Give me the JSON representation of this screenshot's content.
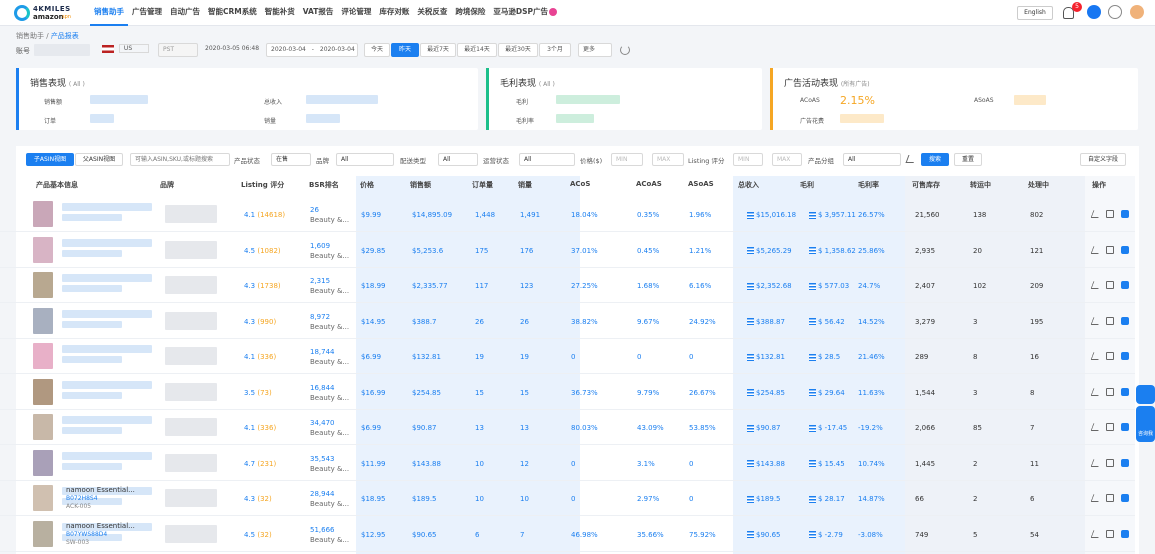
{
  "logo": {
    "line1": "4KMILES",
    "line2": "amazon",
    "line3": "spn"
  },
  "nav": [
    "销售助手",
    "广告管理",
    "自动广告",
    "智能CRM系统",
    "智能补货",
    "VAT报告",
    "评论管理",
    "库存对账",
    "关税反查",
    "跨境保险",
    "亚马逊DSP广告"
  ],
  "header": {
    "lang": "English",
    "notif_count": "5"
  },
  "breadcrumb": {
    "root": "销售助手",
    "sep": " / ",
    "current": "产品报表"
  },
  "filters": {
    "account_label": "账号",
    "country": "US",
    "tz": "PST",
    "datetime": "2020-03-05 06:48",
    "date_from": "2020-03-04",
    "date_to": "2020-03-04",
    "date_sep": "-",
    "quick": [
      "今天",
      "昨天",
      "最近7天",
      "最近14天",
      "最近30天",
      "3个月",
      "更多"
    ]
  },
  "cards": {
    "sales": {
      "title": "销售表现",
      "tag": "( All )",
      "f1": "销售额",
      "f2": "总收入",
      "f3": "订单",
      "f4": "销量"
    },
    "profit": {
      "title": "毛利表现",
      "tag": "( All )",
      "f1": "毛利",
      "f2": "毛利率"
    },
    "ads": {
      "title": "广告活动表现",
      "tag": "(所有广告)",
      "acos_label": "ACoAS",
      "acos_value": "2.15%",
      "asoas_label": "ASoAS",
      "spend_label": "广告花费"
    }
  },
  "toolbar": {
    "tab1": "子ASIN视图",
    "tab2": "父ASIN视图",
    "search_placeholder": "可输入ASIN,SKU,或标题搜索",
    "status_label": "产品状态",
    "status_val": "在售",
    "brand_label": "品牌",
    "brand_val": "All",
    "ship_label": "配送类型",
    "ship_val": "All",
    "op_label": "运营状态",
    "op_val": "All",
    "price_label": "价格($)",
    "min": "MIN",
    "max": "MAX",
    "rating_label": "Listing 评分",
    "group_label": "产品分组",
    "group_val": "All",
    "search_btn": "搜索",
    "reset_btn": "重置",
    "custom_btn": "自定义字段"
  },
  "columns": [
    "产品基本信息",
    "品牌",
    "Listing 评分",
    "BSR排名",
    "价格",
    "销售额",
    "订单量",
    "销量",
    "ACoS",
    "ACoAS",
    "ASoAS",
    "总收入",
    "毛利",
    "毛利率",
    "可售库存",
    "转运中",
    "处理中",
    "操作"
  ],
  "rows": [
    {
      "name": "",
      "asin": "",
      "sku": "",
      "rating": "4.1",
      "reviews": "(14618)",
      "bsr": "26",
      "bsr_cat": "Beauty &...",
      "price": "$9.99",
      "sales": "$14,895.09",
      "orders": "1,448",
      "units": "1,491",
      "acos": "18.04%",
      "acoas": "0.35%",
      "asoas": "1.96%",
      "revenue": "$15,016.18",
      "profit": "$ 3,957.11",
      "margin": "26.57%",
      "stock": "21,560",
      "inbound": "138",
      "processing": "802"
    },
    {
      "name": "",
      "asin": "",
      "sku": "",
      "rating": "4.5",
      "reviews": "(1082)",
      "bsr": "1,609",
      "bsr_cat": "Beauty &...",
      "price": "$29.85",
      "sales": "$5,253.6",
      "orders": "175",
      "units": "176",
      "acos": "37.01%",
      "acoas": "0.45%",
      "asoas": "1.21%",
      "revenue": "$5,265.29",
      "profit": "$ 1,358.62",
      "margin": "25.86%",
      "stock": "2,935",
      "inbound": "20",
      "processing": "121"
    },
    {
      "name": "",
      "asin": "",
      "sku": "",
      "rating": "4.3",
      "reviews": "(1738)",
      "bsr": "2,315",
      "bsr_cat": "Beauty &...",
      "price": "$18.99",
      "sales": "$2,335.77",
      "orders": "117",
      "units": "123",
      "acos": "27.25%",
      "acoas": "1.68%",
      "asoas": "6.16%",
      "revenue": "$2,352.68",
      "profit": "$ 577.03",
      "margin": "24.7%",
      "stock": "2,407",
      "inbound": "102",
      "processing": "209"
    },
    {
      "name": "",
      "asin": "",
      "sku": "",
      "rating": "4.3",
      "reviews": "(990)",
      "bsr": "8,972",
      "bsr_cat": "Beauty &...",
      "price": "$14.95",
      "sales": "$388.7",
      "orders": "26",
      "units": "26",
      "acos": "38.82%",
      "acoas": "9.67%",
      "asoas": "24.92%",
      "revenue": "$388.87",
      "profit": "$ 56.42",
      "margin": "14.52%",
      "stock": "3,279",
      "inbound": "3",
      "processing": "195"
    },
    {
      "name": "",
      "asin": "",
      "sku": "",
      "rating": "4.1",
      "reviews": "(336)",
      "bsr": "18,744",
      "bsr_cat": "Beauty &...",
      "price": "$6.99",
      "sales": "$132.81",
      "orders": "19",
      "units": "19",
      "acos": "0",
      "acoas": "0",
      "asoas": "0",
      "revenue": "$132.81",
      "profit": "$ 28.5",
      "margin": "21.46%",
      "stock": "289",
      "inbound": "8",
      "processing": "16"
    },
    {
      "name": "",
      "asin": "",
      "sku": "",
      "rating": "3.5",
      "reviews": "(73)",
      "bsr": "16,844",
      "bsr_cat": "Beauty &...",
      "price": "$16.99",
      "sales": "$254.85",
      "orders": "15",
      "units": "15",
      "acos": "36.73%",
      "acoas": "9.79%",
      "asoas": "26.67%",
      "revenue": "$254.85",
      "profit": "$ 29.64",
      "margin": "11.63%",
      "stock": "1,544",
      "inbound": "3",
      "processing": "8"
    },
    {
      "name": "",
      "asin": "",
      "sku": "",
      "rating": "4.1",
      "reviews": "(336)",
      "bsr": "34,470",
      "bsr_cat": "Beauty &...",
      "price": "$6.99",
      "sales": "$90.87",
      "orders": "13",
      "units": "13",
      "acos": "80.03%",
      "acoas": "43.09%",
      "asoas": "53.85%",
      "revenue": "$90.87",
      "profit": "$ -17.45",
      "margin": "-19.2%",
      "stock": "2,066",
      "inbound": "85",
      "processing": "7"
    },
    {
      "name": "",
      "asin": "",
      "sku": "",
      "rating": "4.7",
      "reviews": "(231)",
      "bsr": "35,543",
      "bsr_cat": "Beauty &...",
      "price": "$11.99",
      "sales": "$143.88",
      "orders": "10",
      "units": "12",
      "acos": "0",
      "acoas": "3.1%",
      "asoas": "0",
      "revenue": "$143.88",
      "profit": "$ 15.45",
      "margin": "10.74%",
      "stock": "1,445",
      "inbound": "2",
      "processing": "11"
    },
    {
      "name": "namoon Essential...",
      "asin": "B072H8S4",
      "sku": "ACK-005",
      "rating": "4.3",
      "reviews": "(32)",
      "bsr": "28,944",
      "bsr_cat": "Beauty &...",
      "price": "$18.95",
      "sales": "$189.5",
      "orders": "10",
      "units": "10",
      "acos": "0",
      "acoas": "2.97%",
      "asoas": "0",
      "revenue": "$189.5",
      "profit": "$ 28.17",
      "margin": "14.87%",
      "stock": "66",
      "inbound": "2",
      "processing": "6"
    },
    {
      "name": "namoon Essential...",
      "asin": "B07YWS88D4",
      "sku": "SW-003",
      "rating": "4.5",
      "reviews": "(32)",
      "bsr": "51,666",
      "bsr_cat": "Beauty &...",
      "price": "$12.95",
      "sales": "$90.65",
      "orders": "6",
      "units": "7",
      "acos": "46.98%",
      "acoas": "35.66%",
      "asoas": "75.92%",
      "revenue": "$90.65",
      "profit": "$ -2.79",
      "margin": "-3.08%",
      "stock": "749",
      "inbound": "5",
      "processing": "54"
    }
  ],
  "side": {
    "label": "咨询我"
  },
  "colors": {
    "accent": "#1b7ff0",
    "rating": "#f5a623",
    "green": "#1cbf8a",
    "orange": "#f5a623"
  }
}
